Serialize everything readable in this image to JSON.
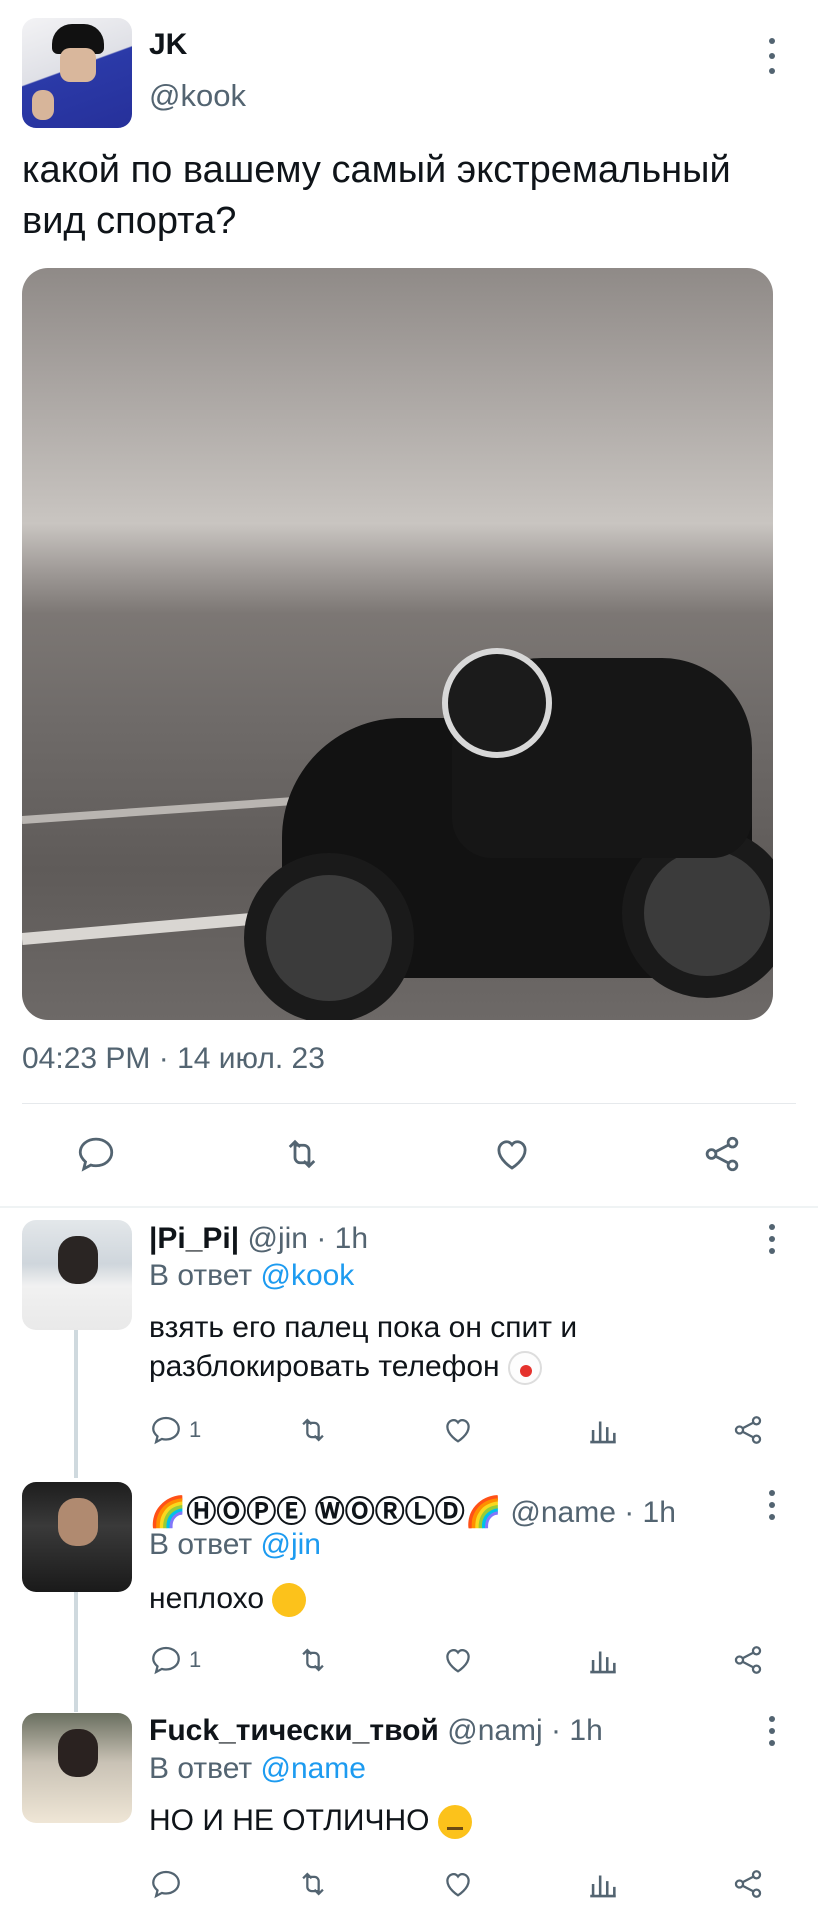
{
  "tweet": {
    "author_name": "JK",
    "author_handle": "@kook",
    "text": "какой по вашему самый экстремальный вид спорта?",
    "timestamp": "04:23 PM · 14 июл. 23",
    "media_icon": "motorcycle-photo"
  },
  "actions": {
    "reply_icon": "reply-icon",
    "retweet_icon": "retweet-icon",
    "like_icon": "heart-icon",
    "share_icon": "share-icon"
  },
  "replies": [
    {
      "name": "|Pi_Pi|",
      "handle": "@jin",
      "time": " · 1h",
      "in_reply_label": "В ответ",
      "in_reply_to": "@kook",
      "text": "взять его палец пока он спит и разблокировать телефон",
      "emoji": "clown-face",
      "reply_count": "1"
    },
    {
      "name": "🌈ⒽⓄⓅⒺ ⓌⓄⓇⓁⒹ🌈",
      "handle": "@name",
      "time": " · 1h",
      "in_reply_label": "В ответ",
      "in_reply_to": "@jin",
      "text": "неплохо",
      "emoji": "rolling-on-floor-laughing",
      "reply_count": "1"
    },
    {
      "name": "Fuck_тически_твой",
      "handle": "@namj",
      "time": " · 1h",
      "in_reply_label": "В ответ",
      "in_reply_to": "@name",
      "text": "НО И НЕ ОТЛИЧНО",
      "emoji": "unamused-face",
      "reply_count": ""
    }
  ],
  "colors": {
    "text": "#0f1419",
    "muted": "#536471",
    "link": "#1d9bf0",
    "divider": "#e6e9ec"
  }
}
